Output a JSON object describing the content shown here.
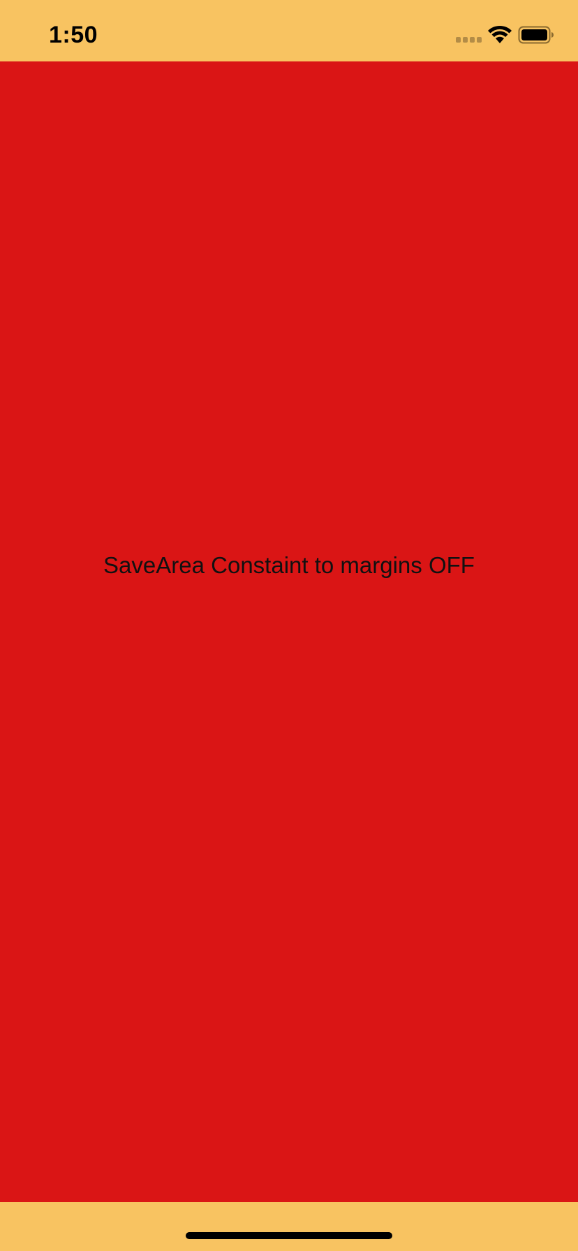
{
  "status_bar": {
    "time": "1:50",
    "signal_icon": "cellular-signal-icon",
    "wifi_icon": "wifi-icon",
    "battery_icon": "battery-icon"
  },
  "content": {
    "label": "SaveArea Constaint to margins OFF"
  },
  "colors": {
    "safe_area_background": "#F8C361",
    "content_background": "#DA1515",
    "signal_dots": "#B38C46",
    "text": "#111111"
  }
}
